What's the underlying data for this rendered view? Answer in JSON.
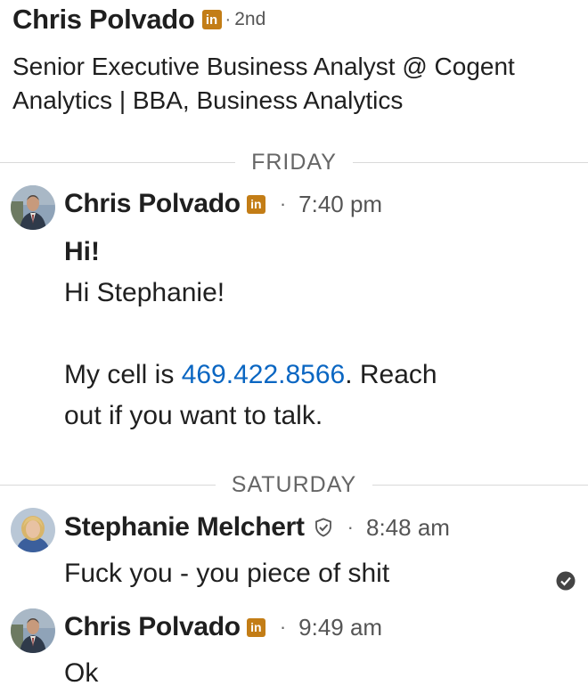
{
  "header": {
    "name": "Chris Polvado",
    "badge": "in",
    "separator": "·",
    "degree": "2nd",
    "headline": "Senior Executive Business Analyst @ Cogent Analytics | BBA, Business Analytics"
  },
  "days": [
    {
      "label": "FRIDAY"
    },
    {
      "label": "SATURDAY"
    }
  ],
  "messages": [
    {
      "sender": "Chris Polvado",
      "badge": "in",
      "dot": "·",
      "time": "7:40 pm",
      "line1": "Hi!",
      "line2": "Hi Stephanie!",
      "line3_prefix": "My cell is ",
      "phone": "469.422.8566",
      "line3_suffix": ". Reach",
      "line4": "out if you want to talk."
    },
    {
      "sender": "Stephanie Melchert",
      "dot": "·",
      "time": "8:48 am",
      "text": "Fuck you - you piece of shit"
    },
    {
      "sender": "Chris Polvado",
      "badge": "in",
      "dot": "·",
      "time": "9:49 am",
      "text": "Ok"
    }
  ],
  "colors": {
    "link": "#0a66c2",
    "linkedin_badge": "#c37d16",
    "divider": "#d9d9d9"
  }
}
